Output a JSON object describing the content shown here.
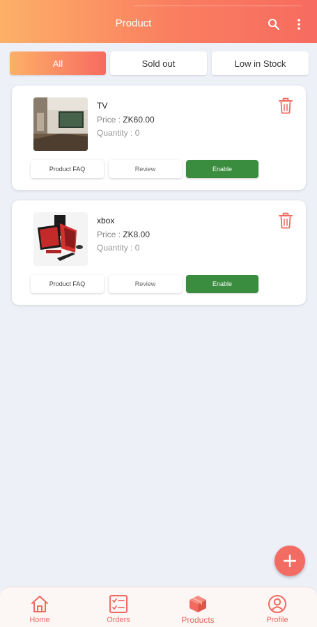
{
  "header": {
    "title": "Product"
  },
  "tabs": [
    {
      "label": "All",
      "active": true
    },
    {
      "label": "Sold out",
      "active": false
    },
    {
      "label": "Low in Stock",
      "active": false
    }
  ],
  "products": [
    {
      "name": "TV",
      "price_label": "Price : ",
      "price_value": "ZK60.00",
      "quantity_label": "Quantity : 0",
      "faq_label": "Product FAQ",
      "review_label": "Review",
      "enable_label": "Enable"
    },
    {
      "name": "xbox",
      "price_label": "Price : ",
      "price_value": "ZK8.00",
      "quantity_label": "Quantity : 0",
      "faq_label": "Product FAQ",
      "review_label": "Review",
      "enable_label": "Enable"
    }
  ],
  "nav": [
    {
      "label": "Home",
      "icon": "home-icon"
    },
    {
      "label": "Orders",
      "icon": "orders-icon"
    },
    {
      "label": "Products",
      "icon": "products-box-icon"
    },
    {
      "label": "Profile",
      "icon": "profile-icon"
    }
  ],
  "colors": {
    "accent": "#f76b60",
    "gradient_start": "#fdb068",
    "enable_green": "#3a8d3e",
    "background": "#eef0f8"
  }
}
